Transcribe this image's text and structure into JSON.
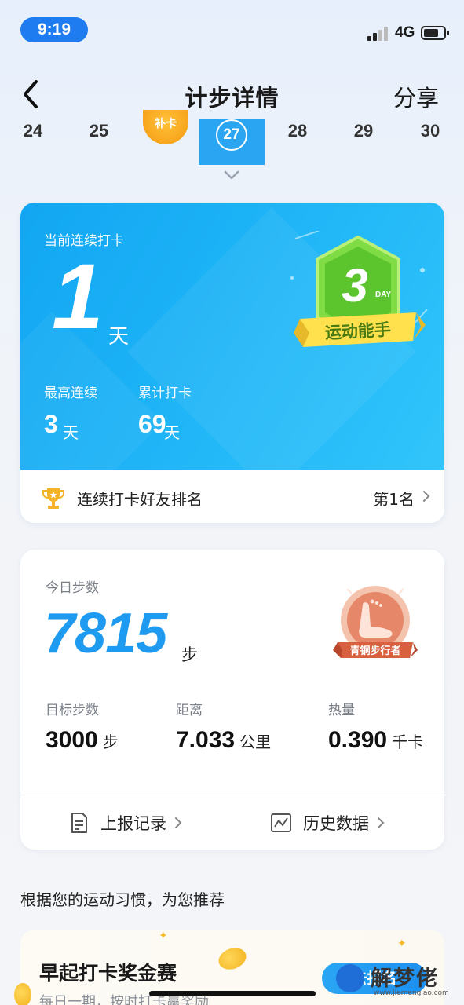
{
  "status_bar": {
    "time": "9:19",
    "network": "4G"
  },
  "nav": {
    "title": "计步详情",
    "share": "分享"
  },
  "dates": [
    "24",
    "25",
    "27",
    "28",
    "29",
    "30"
  ],
  "checkin_badge": "补卡",
  "streak": {
    "label": "当前连续打卡",
    "days": "1",
    "unit": "天",
    "max_label": "最高连续",
    "max_value": "3",
    "max_unit": "天",
    "total_label": "累计打卡",
    "total_value": "69",
    "total_unit": "天",
    "badge_number": "3",
    "badge_day": "DAY",
    "badge_text": "运动能手",
    "rank_label": "连续打卡好友排名",
    "rank_value": "第1名"
  },
  "steps": {
    "label": "今日步数",
    "value": "7815",
    "unit": "步",
    "badge_text": "青铜步行者",
    "metrics": [
      {
        "label": "目标步数",
        "value": "3000",
        "unit": "步"
      },
      {
        "label": "距离",
        "value": "7.033",
        "unit": "公里"
      },
      {
        "label": "热量",
        "value": "0.390",
        "unit": "千卡"
      }
    ],
    "report_link": "上报记录",
    "history_link": "历史数据"
  },
  "recommend": {
    "heading": "根据您的运动习惯，为您推荐",
    "card_title": "早起打卡奖金赛",
    "card_sub": "每日一期，按时打卡赢奖励",
    "button": "去报名"
  },
  "watermark": {
    "text": "解梦佬",
    "url": "www.jiemengiao.com"
  },
  "colors": {
    "accent": "#1e9bf0",
    "streak_bg": "#1cb2f6",
    "time_pill": "#1f7cf0",
    "badge_green": "#6fd23a",
    "bronze": "#e0795a"
  }
}
